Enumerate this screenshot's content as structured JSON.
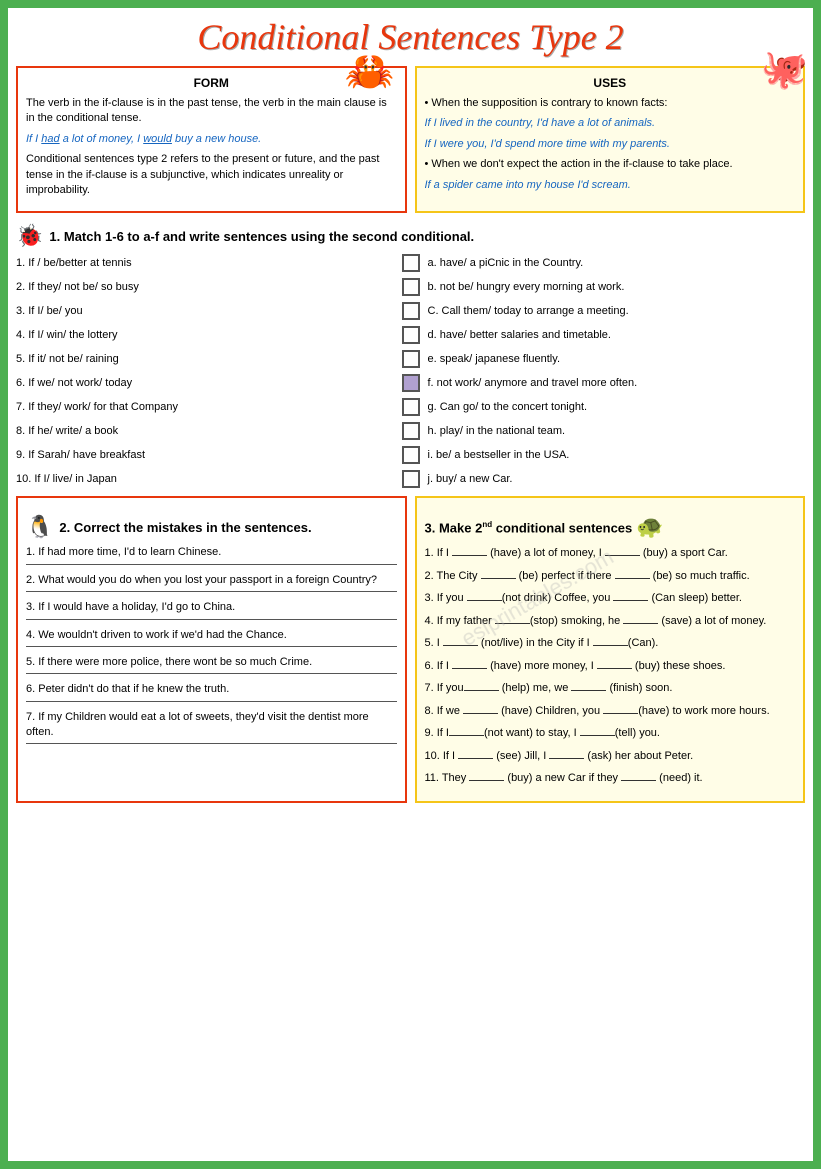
{
  "title": "Conditional Sentences Type 2",
  "form": {
    "header": "FORM",
    "text1": "The verb in the if-clause is in the past tense, the verb in the main clause is in the conditional tense.",
    "example1": "If I had a lot of money, I would buy a new house.",
    "text2": "Conditional sentences type 2 refers to the present or future, and the past tense in the if-clause is a subjunctive, which indicates unreality or improbability."
  },
  "uses": {
    "header": "USES",
    "bullet1": "When the supposition is contrary to known facts:",
    "ex1": "If I lived in the country, I'd have a lot of animals.",
    "ex2": "If I were you, I'd spend more time with my parents.",
    "bullet2": "When we don't expect the action in the if-clause to take place.",
    "ex3": "If a spider came into my house I'd scream."
  },
  "exercise1": {
    "header": "1. Match 1-6 to a-f and write sentences using the second conditional.",
    "items_left": [
      "1. If / be/better at tennis",
      "2. If they/ not be/ so busy",
      "3. If I/ be/ you",
      "4. If I/ win/ the lottery",
      "5. If it/ not be/ raining",
      "6. If we/ not work/ today",
      "7. If they/ work/ for that Company",
      "8. If he/ write/ a book",
      "9. If Sarah/ have breakfast",
      "10. If I/ live/ in Japan"
    ],
    "items_right": [
      "a. have/ a piCnic in the Country.",
      "b. not be/ hungry every morning at work.",
      "C. Call them/ today to arrange a meeting.",
      "d. have/ better salaries and timetable.",
      "e. speak/ japanese fluently.",
      "f. not work/ anymore and travel more often.",
      "g. Can go/ to the concert tonight.",
      "h. play/ in the national team.",
      "i. be/ a bestseller in the USA.",
      "j. buy/ a new Car."
    ]
  },
  "exercise2": {
    "header": "2. Correct the mistakes in the sentences.",
    "items": [
      "1. If had more time, I'd to learn Chinese.",
      "2. What would you do when you lost your passport in a foreign Country?",
      "3. If I would have a holiday, I'd go to China.",
      "4. We wouldn't driven to work if we'd had the Chance.",
      "5. If there were more police, there wont be so much Crime.",
      "6. Peter didn't do that if he knew the truth.",
      "7. If my Children would eat a lot of sweets, they'd visit the dentist more often."
    ]
  },
  "exercise3": {
    "header": "3. Make 2",
    "header_sup": "nd",
    "header_end": " conditional sentences",
    "items": [
      "1. If I _____ (have) a lot of money, I ____ (buy) a sport Car.",
      "2. The City ____ (be) perfect if there ____ (be) so much traffic.",
      "3. If you ______(not drink) Coffee, you _____ (Can sleep) better.",
      "4. If my father ______(stop) smoking, he ___ (save) a lot of money.",
      "5. I _____ (not/live) in the City if I ____(Can).",
      "6. If I ____ (have) more money, I ____ (buy) these shoes.",
      "7. If you_____ (help) me, we _____ (finish) soon.",
      "8. If we _____ (have) Children, you _____(have) to work more hours.",
      "9. If I______(not want) to stay, I ____(tell) you.",
      "10. If I ___ (see) Jill, I ___ (ask) her about Peter.",
      "11. They ___ (buy) a new Car if they _____ (need) it."
    ]
  }
}
